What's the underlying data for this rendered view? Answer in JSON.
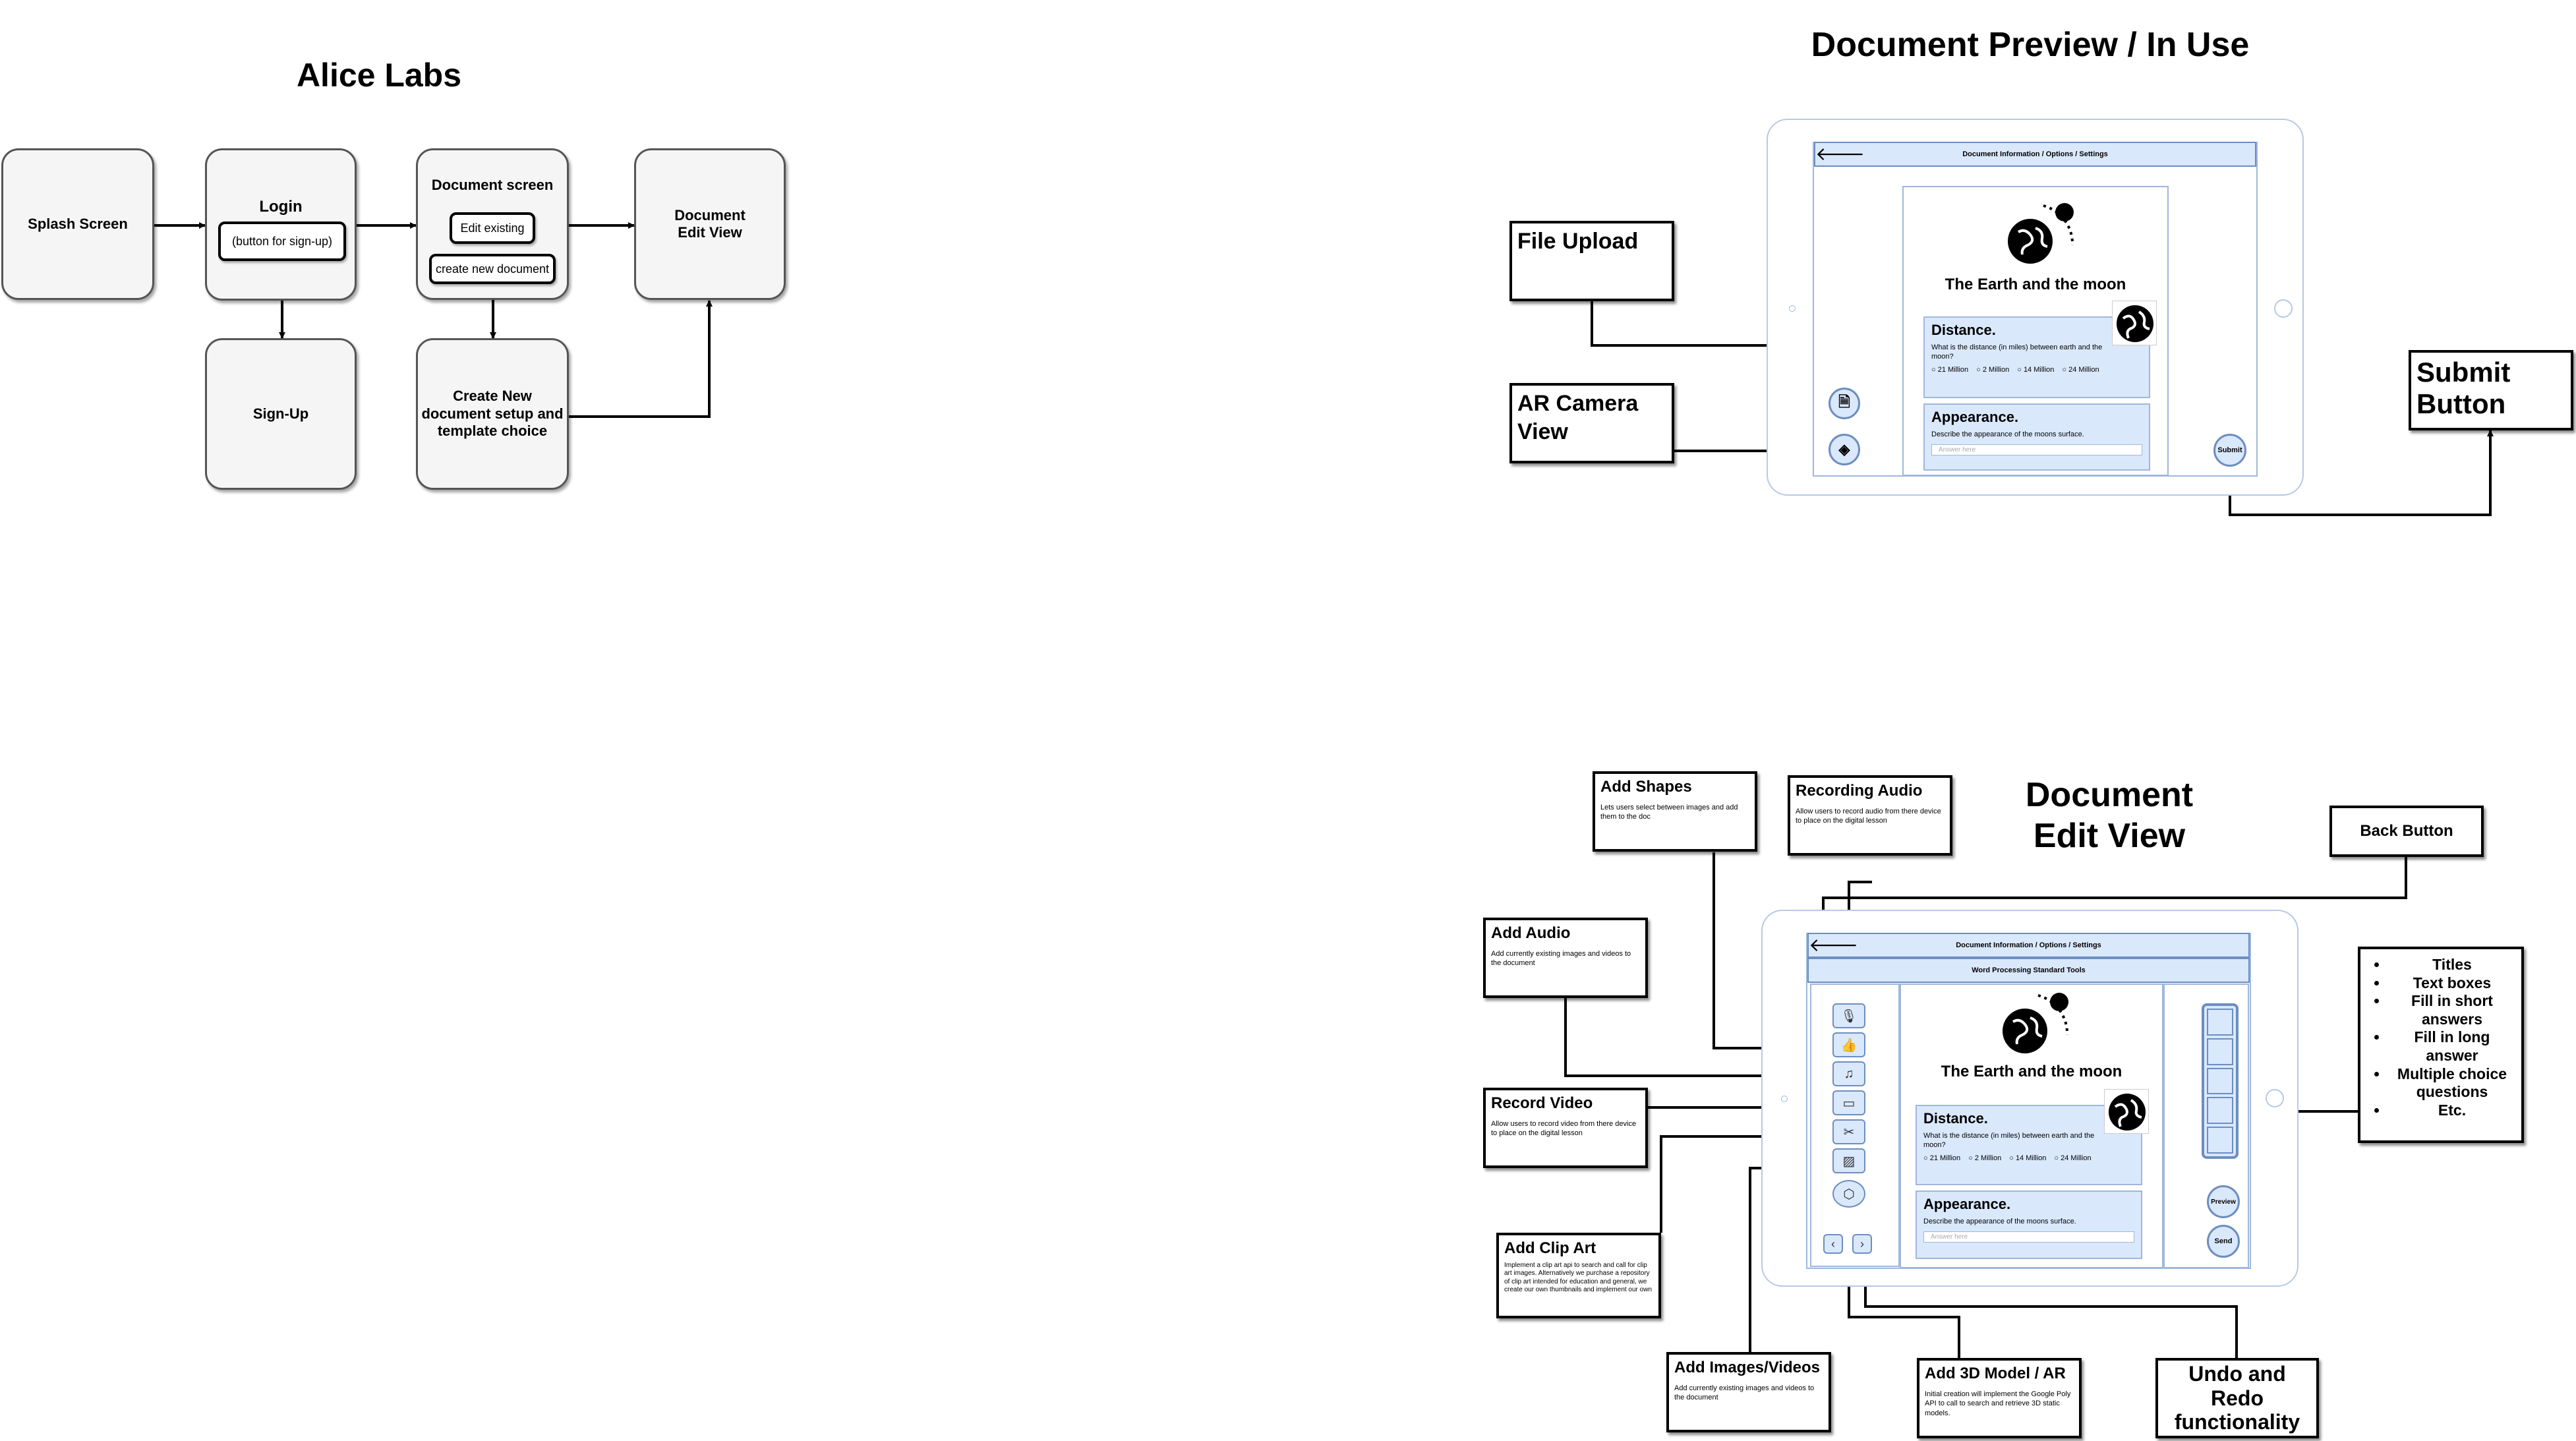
{
  "flowchart": {
    "title": "Alice Labs",
    "splash": "Splash Screen",
    "login": "Login",
    "login_signup_button": "(button for sign-up)",
    "document_screen": "Document screen",
    "edit_existing": "Edit existing",
    "create_new_document": "create new document",
    "document_edit_view_line1": "Document",
    "document_edit_view_line2": "Edit View",
    "signup": "Sign-Up",
    "create_new_setup_line1": "Create New",
    "create_new_setup_line2": "document setup and",
    "create_new_setup_line3": "template choice"
  },
  "preview": {
    "title": "Document Preview / In Use",
    "top_bar": "Document Information / Options / Settings",
    "lesson_title": "The Earth and the moon",
    "distance_title": "Distance.",
    "distance_question": "What is the distance (in miles) between earth and the moon?",
    "options": [
      "21 Million",
      "2 Million",
      "14 Million",
      "24 Million"
    ],
    "appearance_title": "Appearance.",
    "appearance_question": "Describe the appearance of the moons surface.",
    "answer_placeholder": "Answer here",
    "submit_button": "Submit",
    "callouts": {
      "file_upload": "File Upload",
      "ar_camera_line1": "AR Camera",
      "ar_camera_line2": "View",
      "submit_line1": "Submit",
      "submit_line2": "Button"
    }
  },
  "edit_view": {
    "title_line1": "Document",
    "title_line2": "Edit View",
    "top_bar": "Document Information / Options / Settings",
    "second_bar": "Word Processing Standard Tools",
    "lesson_title": "The Earth and the moon",
    "distance_title": "Distance.",
    "distance_question": "What is the distance (in miles) between earth and the moon?",
    "options": [
      "21 Million",
      "2 Million",
      "14 Million",
      "24 Million"
    ],
    "appearance_title": "Appearance.",
    "appearance_question": "Describe the appearance of the moons surface.",
    "answer_placeholder": "Answer here",
    "preview_button": "Preview",
    "send_button": "Send",
    "callouts": {
      "add_shapes_title": "Add Shapes",
      "add_shapes_desc": "Lets users select between images and add them to the doc",
      "recording_audio_title": "Recording Audio",
      "recording_audio_desc": "Allow users to record audio from there device to place on the digital lesson",
      "back_button": "Back Button",
      "add_audio_title": "Add Audio",
      "add_audio_desc": "Add currently existing images and videos to the document",
      "record_video_title": "Record Video",
      "record_video_desc": "Allow users to record video from there device to place on the digital lesson",
      "add_clip_art_title": "Add Clip Art",
      "add_clip_art_desc": "Implement a clip art api to search and call for clip art images. Alternatively we purchase a repository of clip art intended for education and general, we create our own thumbnails and implement our own",
      "add_images_title": "Add Images/Videos",
      "add_images_desc": "Add currently existing images and videos to the document",
      "add_3d_title": "Add 3D Model / AR",
      "add_3d_desc": "Initial creation will implement the Google Poly API to call to search and retrieve 3D static models.",
      "undo_redo_line1": "Undo and Redo",
      "undo_redo_line2": "functionality",
      "bullet_items": [
        "Titles",
        "Text boxes",
        "Fill in short answers",
        "Fill in long answer",
        "Multiple choice questions",
        "Etc."
      ]
    }
  },
  "colors": {
    "accent_fill": "#dae8fc",
    "accent_stroke": "#6c8ebf",
    "flow_fill": "#f5f5f5"
  },
  "icons": [
    "back-arrow-icon",
    "earth-moon-icon",
    "globe-icon",
    "file-upload-icon",
    "ar-camera-icon",
    "microphone-icon",
    "thumbs-up-icon",
    "music-note-icon",
    "video-camera-icon",
    "clip-art-icon",
    "image-icon",
    "cube-3d-icon",
    "chevron-left-icon",
    "chevron-right-icon"
  ]
}
